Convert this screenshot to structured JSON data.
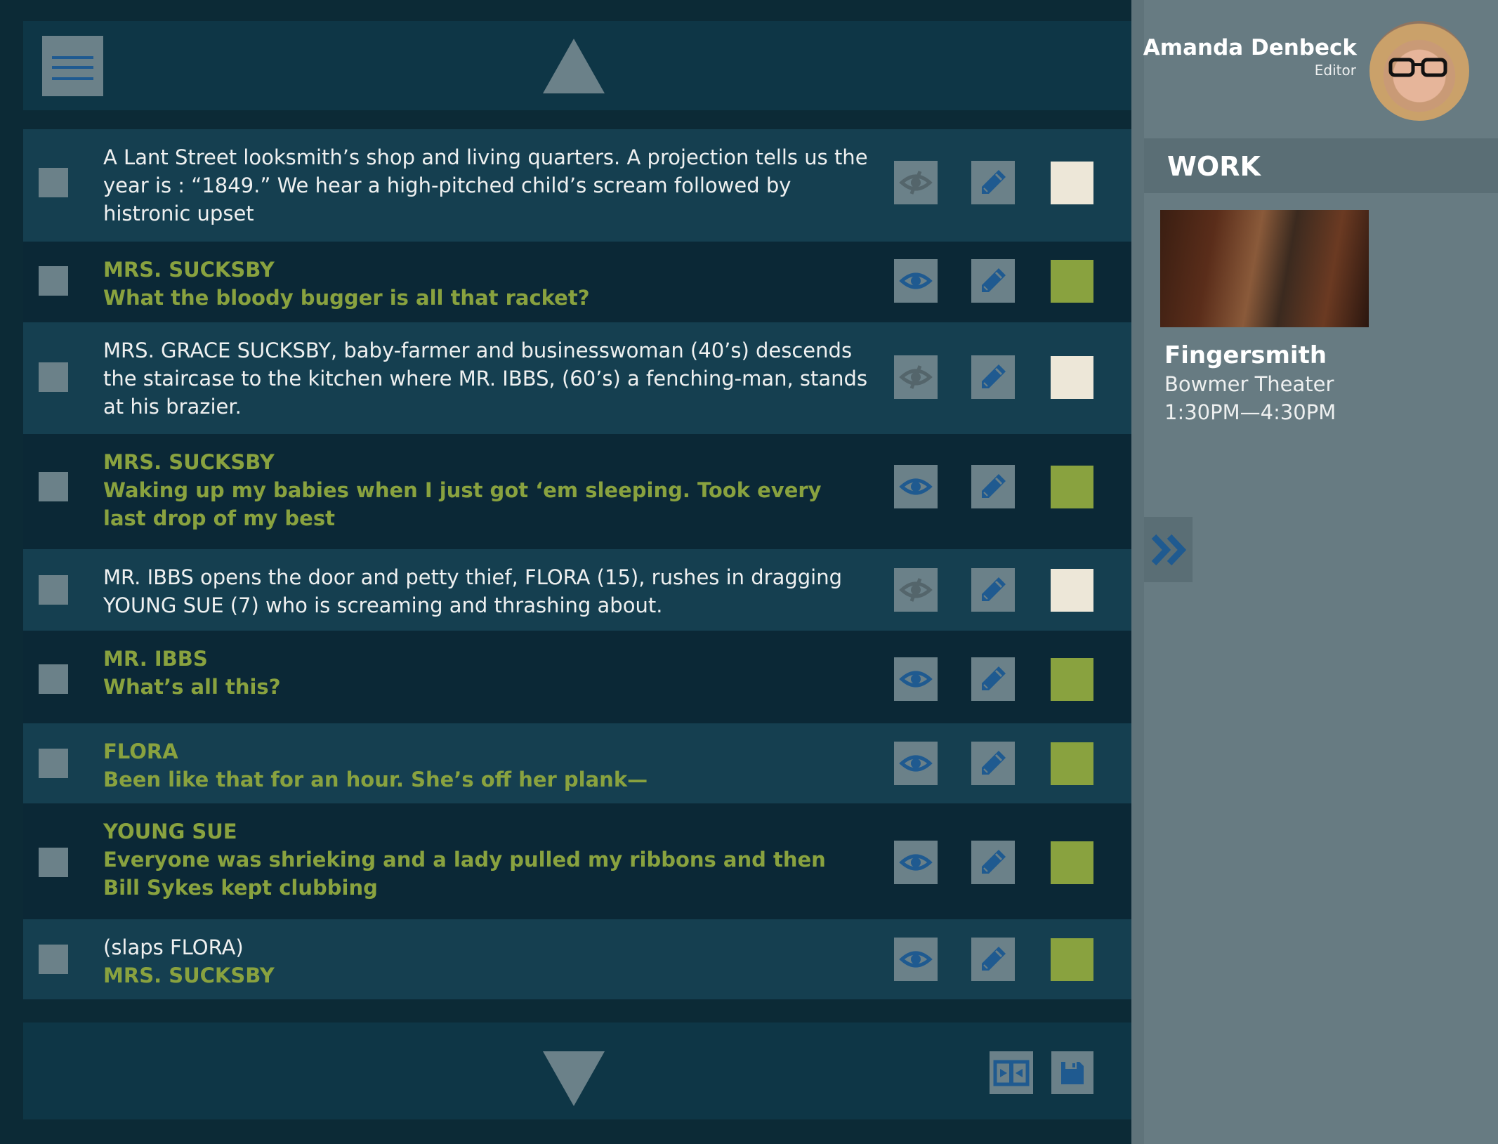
{
  "user": {
    "name": "Amanda Denbeck",
    "role": "Editor"
  },
  "work": {
    "header": "WORK",
    "title": "Fingersmith",
    "venue": "Bowmer Theater",
    "time": "1:30PM—4:30PM"
  },
  "colors": {
    "accent_green": "#89a23f",
    "cream": "#ede7d8",
    "icon_blue": "#1f5a90",
    "button_gray": "#6b8189"
  },
  "icons": {
    "menu": "hamburger-icon",
    "scroll_up": "triangle-up-icon",
    "scroll_down": "triangle-down-icon",
    "visible": "eye-icon",
    "hidden": "eye-slash-icon",
    "edit": "pencil-icon",
    "expand": "double-chevron-right-icon",
    "split": "split-view-icon",
    "save": "floppy-disk-icon"
  },
  "script_rows": [
    {
      "type": "direction",
      "text": "A Lant Street looksmith’s shop and living quarters. A projection tells us the year is : “1849.” We hear a high-pitched child’s scream followed by histronic upset",
      "visible": false
    },
    {
      "type": "dialogue",
      "speaker": "MRS. SUCKSBY",
      "line": "What the bloody bugger is all that racket?",
      "visible": true
    },
    {
      "type": "direction",
      "text": "MRS. GRACE SUCKSBY, baby-farmer and businesswoman (40’s) descends the staircase to the kitchen where MR. IBBS, (60’s) a fenching-man, stands at his brazier.",
      "visible": false
    },
    {
      "type": "dialogue",
      "speaker": "MRS. SUCKSBY",
      "line": "Waking up my babies when I just got ‘em sleeping. Took every last drop of my best",
      "visible": true
    },
    {
      "type": "direction",
      "text": "MR. IBBS opens the door and petty thief, FLORA (15), rushes in dragging YOUNG SUE (7) who is screaming and thrashing about.",
      "visible": false
    },
    {
      "type": "dialogue",
      "speaker": "MR. IBBS",
      "line": "What’s all this?",
      "visible": true
    },
    {
      "type": "dialogue",
      "speaker": "FLORA",
      "line": "Been like that for an hour. She’s off her plank—",
      "visible": true
    },
    {
      "type": "dialogue",
      "speaker": "YOUNG SUE",
      "line": "Everyone was shrieking and a lady pulled my ribbons and then Bill Sykes kept clubbing",
      "visible": true
    },
    {
      "type": "mixed",
      "direction": "(slaps FLORA)",
      "speaker": "MRS. SUCKSBY",
      "visible": true
    }
  ]
}
